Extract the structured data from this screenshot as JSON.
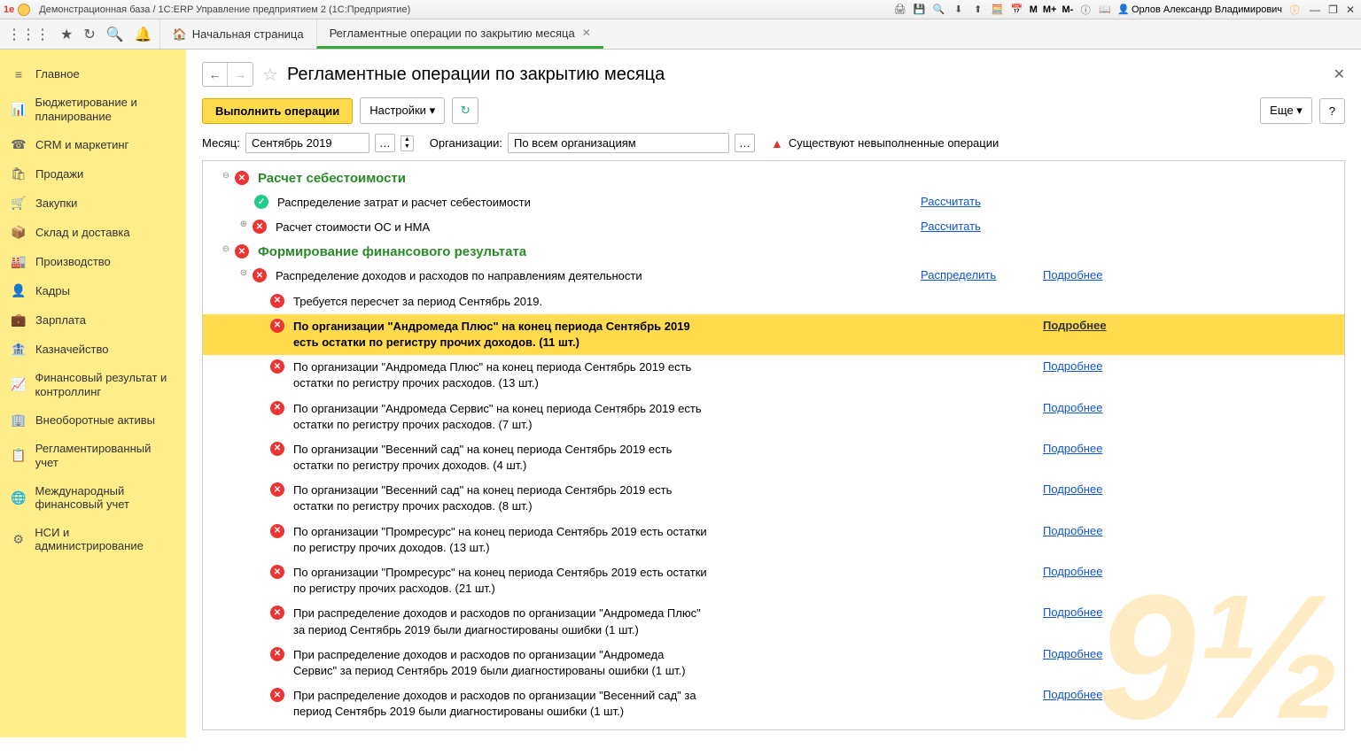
{
  "titlebar": {
    "title": "Демонстрационная база / 1С:ERP Управление предприятием 2  (1С:Предприятие)",
    "m1": "M",
    "m2": "M+",
    "m3": "M-",
    "user": "Орлов Александр Владимирович"
  },
  "tabs": {
    "home": "Начальная страница",
    "active": "Регламентные операции по закрытию месяца"
  },
  "sidebar": [
    {
      "icon": "≡",
      "label": "Главное"
    },
    {
      "icon": "📊",
      "label": "Бюджетирование и планирование"
    },
    {
      "icon": "☎",
      "label": "CRM и маркетинг"
    },
    {
      "icon": "🛍",
      "label": "Продажи"
    },
    {
      "icon": "🛒",
      "label": "Закупки"
    },
    {
      "icon": "📦",
      "label": "Склад и доставка"
    },
    {
      "icon": "🏭",
      "label": "Производство"
    },
    {
      "icon": "👤",
      "label": "Кадры"
    },
    {
      "icon": "💼",
      "label": "Зарплата"
    },
    {
      "icon": "🏦",
      "label": "Казначейство"
    },
    {
      "icon": "📈",
      "label": "Финансовый результат и контроллинг"
    },
    {
      "icon": "🏢",
      "label": "Внеоборотные активы"
    },
    {
      "icon": "📋",
      "label": "Регламентированный учет"
    },
    {
      "icon": "🌐",
      "label": "Международный финансовый учет"
    },
    {
      "icon": "⚙",
      "label": "НСИ и администрирование"
    }
  ],
  "page": {
    "title": "Регламентные операции по закрытию месяца",
    "execute": "Выполнить операции",
    "settings": "Настройки",
    "more": "Еще",
    "help": "?",
    "month_label": "Месяц:",
    "month": "Сентябрь 2019",
    "org_label": "Организации:",
    "org": "По всем организациям",
    "warn": "Существуют невыполненные операции"
  },
  "sections": {
    "s1": "Расчет себестоимости",
    "s2": "Формирование финансового результата"
  },
  "rows": {
    "r1": "Распределение затрат и расчет себестоимости",
    "r2": "Расчет стоимости ОС и НМА",
    "r3": "Распределение доходов и расходов по направлениям деятельности",
    "r4": "Требуется пересчет за период Сентябрь 2019.",
    "r5": "По организации \"Андромеда Плюс\" на конец периода Сентябрь 2019 есть остатки по регистру прочих доходов. (11 шт.)",
    "r6": "По организации \"Андромеда Плюс\" на конец периода Сентябрь 2019 есть остатки по регистру прочих расходов. (13 шт.)",
    "r7": "По организации \"Андромеда Сервис\" на конец периода Сентябрь 2019 есть остатки по регистру прочих расходов. (7 шт.)",
    "r8": "По организации \"Весенний сад\" на конец периода Сентябрь 2019 есть остатки по регистру прочих доходов. (4 шт.)",
    "r9": "По организации \"Весенний сад\" на конец периода Сентябрь 2019 есть остатки по регистру прочих расходов. (8 шт.)",
    "r10": "По организации \"Промресурс\" на конец периода Сентябрь 2019 есть остатки по регистру прочих доходов. (13 шт.)",
    "r11": "По организации \"Промресурс\" на конец периода Сентябрь 2019 есть остатки по регистру прочих расходов. (21 шт.)",
    "r12": "При распределение доходов и расходов по организации \"Андромеда Плюс\" за период Сентябрь 2019 были диагностированы ошибки (1 шт.)",
    "r13": "При распределение доходов и расходов по организации \"Андромеда Сервис\" за период Сентябрь 2019 были диагностированы ошибки (1 шт.)",
    "r14": "При распределение доходов и расходов по организации \"Весенний сад\" за период Сентябрь 2019 были диагностированы ошибки (1 шт.)"
  },
  "links": {
    "calc": "Рассчитать",
    "dist": "Распределить",
    "more": "Подробнее"
  }
}
